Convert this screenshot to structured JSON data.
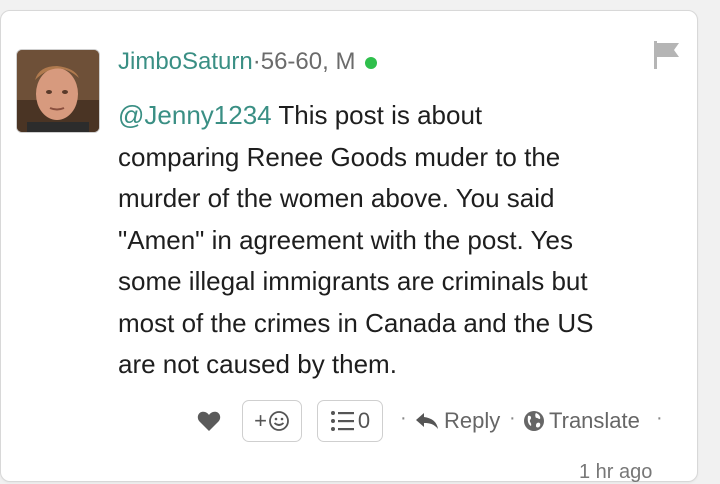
{
  "comment": {
    "username": "JimboSaturn",
    "separator": " · ",
    "age_gender": "56-60, M",
    "mention": "@Jenny1234",
    "body_lines": [
      " This post is about",
      "comparing Renee Goods muder to the",
      "murder of the women above. You said",
      "\"Amen\" in agreement with the post. Yes",
      "some illegal immigrants are criminals but",
      "most of the crimes in Canada and the US",
      "are not caused by them."
    ],
    "avatar_icon": "user-photo",
    "status": "online",
    "colors": {
      "username": "#3a8f84",
      "online": "#2fbf4c"
    }
  },
  "actions": {
    "like_icon": "heart-icon",
    "add_reaction_label": "+",
    "reaction_count": "0",
    "reply_label": "Reply",
    "translate_label": "Translate",
    "dot": "·"
  },
  "timestamp": "1 hr ago"
}
